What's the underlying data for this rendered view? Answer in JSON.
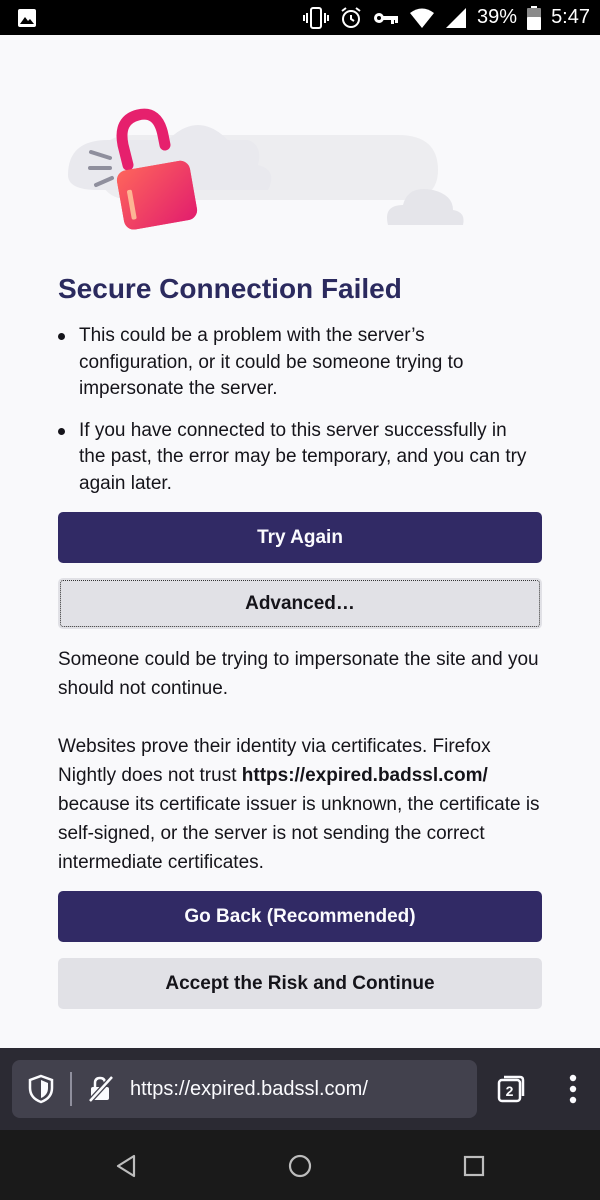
{
  "status_bar": {
    "battery_percent": "39%",
    "time": "5:47"
  },
  "error_page": {
    "title": "Secure Connection Failed",
    "bullets": [
      "This could be a problem with the server’s configuration, or it could be someone trying to impersonate the server.",
      "If you have connected to this server successfully in the past, the error may be temporary, and you can try again later."
    ],
    "try_again_label": "Try Again",
    "advanced_label": "Advanced…",
    "warning_text": "Someone could be trying to impersonate the site and you should not continue.",
    "cert_text_before": "Websites prove their identity via certificates. Firefox Nightly does not trust ",
    "cert_host": "https://expired.badssl.com/",
    "cert_text_after": " because its certificate issuer is unknown, the certificate is self-signed, or the server is not sending the correct intermediate certificates.",
    "go_back_label": "Go Back (Recommended)",
    "accept_risk_label": "Accept the Risk and Continue"
  },
  "toolbar": {
    "url": "https://expired.badssl.com/",
    "tab_count": "2"
  },
  "colors": {
    "primary_button": "#312a65",
    "title": "#2b2a5e",
    "secondary_button": "#e1e1e6",
    "toolbar": "#2b2a33"
  }
}
